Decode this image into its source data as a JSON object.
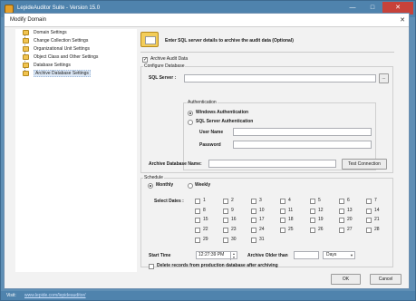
{
  "app": {
    "title": "LepideAuditor Suite - Version 15.0",
    "window_buttons": [
      "—",
      "□",
      "✕"
    ],
    "status_label": "Visit:",
    "status_link": "www.lepide.com/lepideauditor/"
  },
  "dialog": {
    "title": "Modify Domain",
    "close_glyph": "✕"
  },
  "tree": {
    "items": [
      {
        "label": "Domain Settings",
        "selected": false
      },
      {
        "label": "Change Collection Settings",
        "selected": false
      },
      {
        "label": "Organizational Unit Settings",
        "selected": false
      },
      {
        "label": "Object Class and Other Settings",
        "selected": false
      },
      {
        "label": "Database Settings",
        "selected": false
      },
      {
        "label": "Archive Database Settings",
        "selected": true
      }
    ]
  },
  "panel": {
    "banner": "Enter SQL server details to archive the audit data (Optional)",
    "banner_icon": "database-folder-icon",
    "archive_checkbox_label": "Archive Audit Data",
    "archive_checked": true,
    "configure_group": "Configure Database",
    "sql_server_label": "SQL Server :",
    "sql_server_value": "",
    "browse_label": "...",
    "auth_group": "Authentication",
    "auth_options": [
      {
        "label": "Windows Authentication",
        "selected": true
      },
      {
        "label": "SQL Server Authentication",
        "selected": false
      }
    ],
    "username_label": "User Name",
    "username_value": "",
    "password_label": "Password",
    "password_value": "",
    "archive_db_label": "Archive Database Name:",
    "archive_db_value": "",
    "test_connection_label": "Test Connection",
    "schedule_group": "Schedule",
    "schedule_options": [
      {
        "label": "Monthly",
        "selected": true
      },
      {
        "label": "Weekly",
        "selected": false
      }
    ],
    "select_dates_label": "Select Dates :",
    "dates": [
      [
        "1",
        "2",
        "3",
        "4",
        "5",
        "6",
        "7"
      ],
      [
        "8",
        "9",
        "10",
        "11",
        "12",
        "13",
        "14"
      ],
      [
        "15",
        "16",
        "17",
        "18",
        "19",
        "20",
        "21"
      ],
      [
        "22",
        "23",
        "24",
        "25",
        "26",
        "27",
        "28"
      ],
      [
        "29",
        "30",
        "31"
      ]
    ],
    "start_time_label": "Start Time",
    "start_time_value": "12:27:39 PM",
    "older_than_label": "Archive Older than",
    "older_than_value": "",
    "unit_value": "Days",
    "delete_label": "Delete records from production database after archiving",
    "delete_checked": false
  },
  "footer": {
    "ok_label": "OK",
    "cancel_label": "Cancel"
  }
}
